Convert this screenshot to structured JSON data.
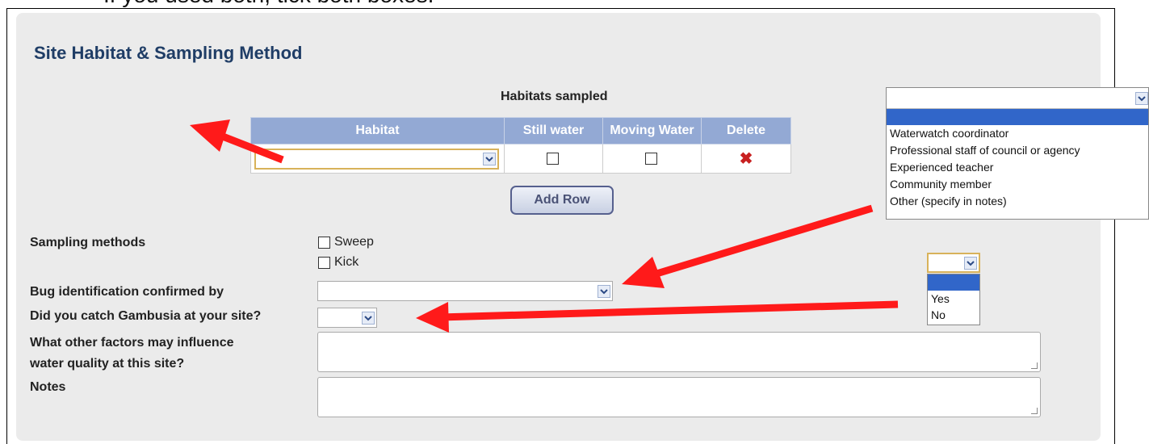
{
  "instruction_fragment": "If you used both, tick both boxes.",
  "section": {
    "title": "Site Habitat & Sampling Method"
  },
  "habitats": {
    "caption": "Habitats sampled",
    "columns": [
      "Habitat",
      "Still water",
      "Moving Water",
      "Delete"
    ],
    "add_row_label": "Add Row"
  },
  "sampling": {
    "label": "Sampling methods",
    "options": [
      "Sweep",
      "Kick"
    ]
  },
  "bug_id": {
    "label": "Bug identification confirmed by"
  },
  "gambusia": {
    "label": "Did you catch Gambusia at your site?"
  },
  "factors": {
    "label_line1": "What other factors may influence",
    "label_line2": "water quality at this site?"
  },
  "notes": {
    "label": "Notes"
  },
  "confirmed_by_dropdown": {
    "options": [
      "Waterwatch coordinator",
      "Professional staff of council or agency",
      "Experienced teacher",
      "Community member",
      "Other (specify in notes)"
    ]
  },
  "gambusia_dropdown": {
    "options": [
      "Yes",
      "No"
    ]
  },
  "colors": {
    "arrow": "#ff1a1a",
    "header_bg": "#93a9d4",
    "title": "#1f3d66",
    "highlight": "#3166c9"
  },
  "icons": {
    "delete": "delete-x-icon",
    "dropdown": "chevron-down-icon"
  }
}
